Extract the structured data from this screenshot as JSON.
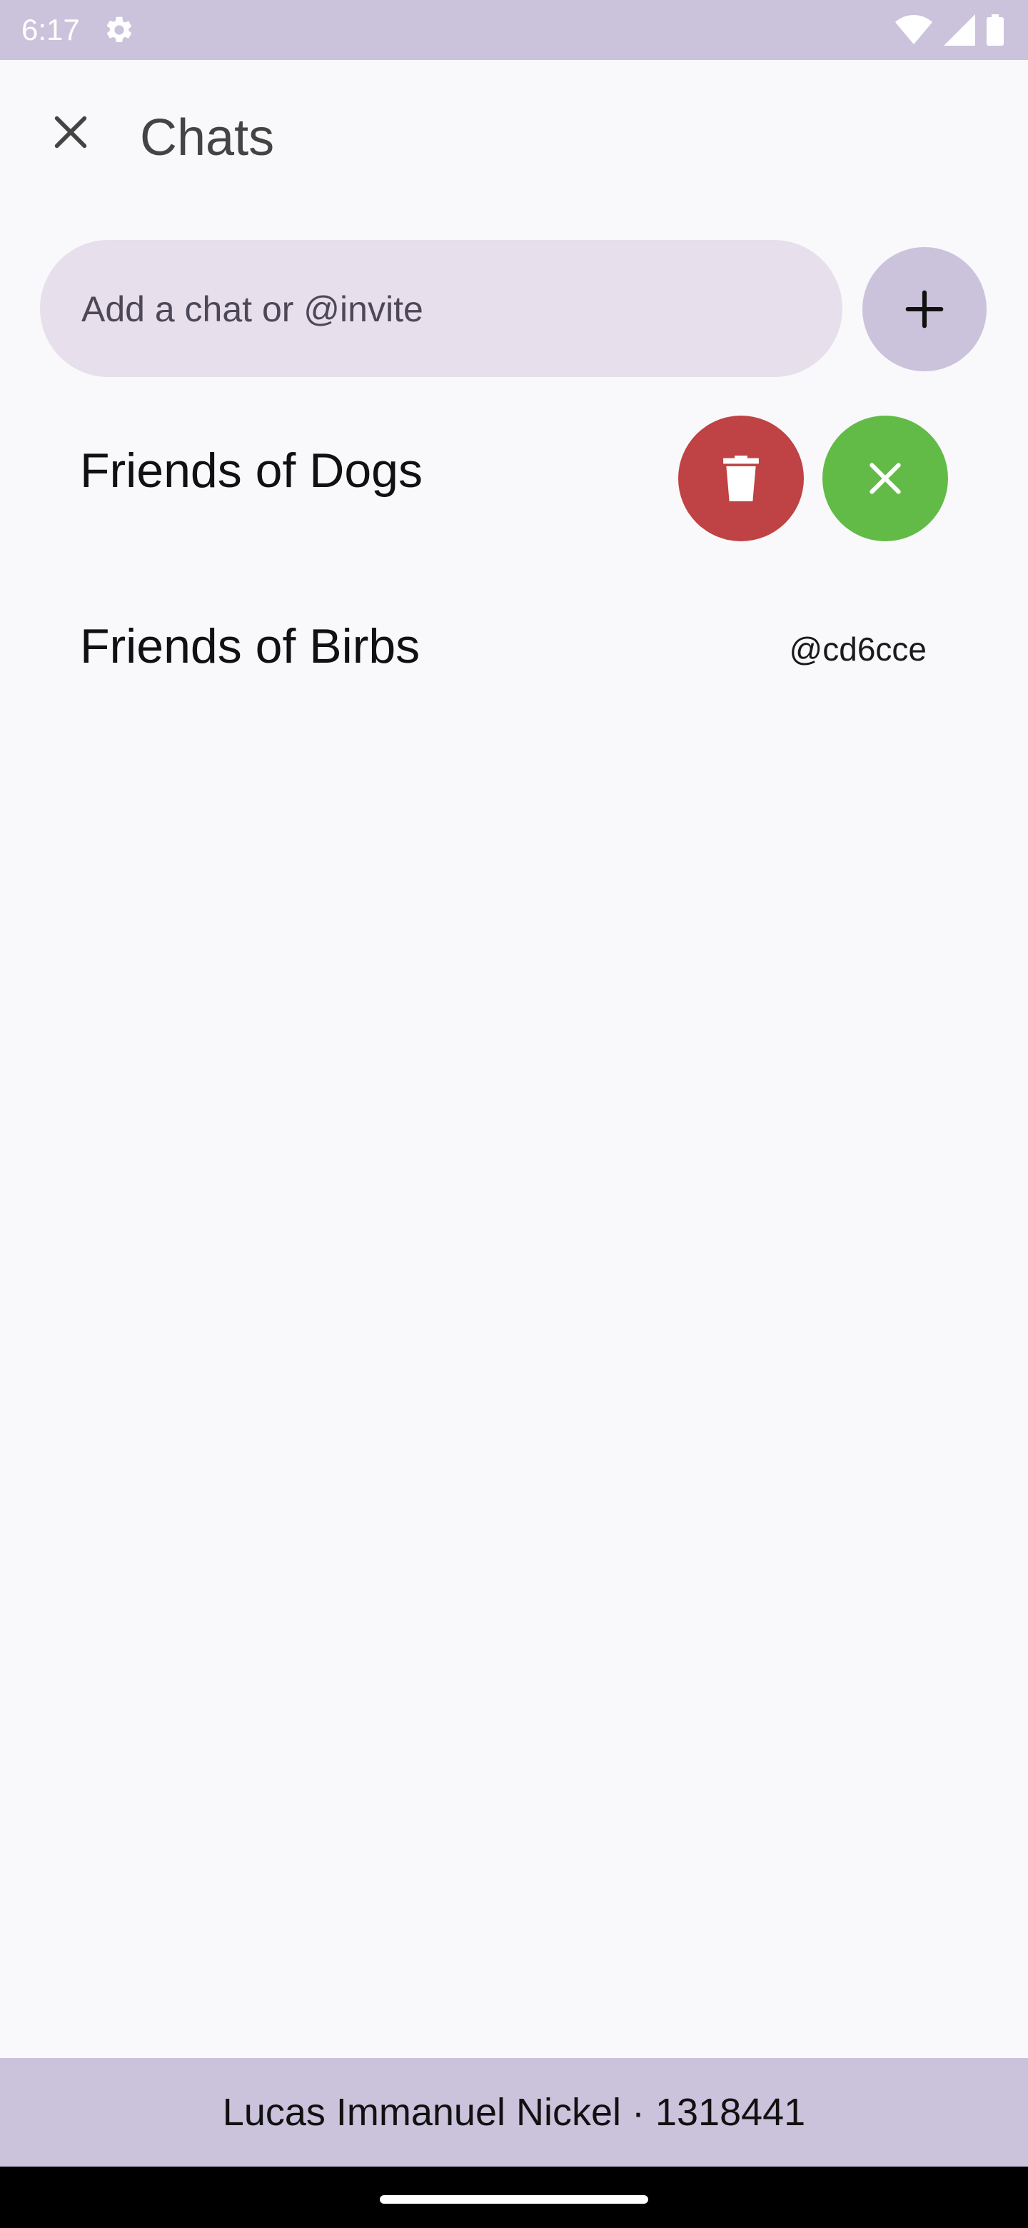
{
  "status_bar": {
    "time": "6:17",
    "icons": [
      "settings-icon",
      "wifi-icon",
      "signal-icon",
      "battery-icon"
    ]
  },
  "header": {
    "title": "Chats",
    "close_icon": "close-icon"
  },
  "composer": {
    "placeholder": "Add a chat or @invite",
    "add_icon": "plus-icon"
  },
  "chats": [
    {
      "name": "Friends of Dogs",
      "handle": "",
      "actions": [
        "delete",
        "confirm"
      ]
    },
    {
      "name": "Friends of Birbs",
      "handle": "@cd6cce"
    }
  ],
  "footer": {
    "text": "Lucas Immanuel Nickel · 1318441"
  },
  "colors": {
    "accent": "#cbc2dc",
    "input_bg": "#e7dfec",
    "delete": "#bf4244",
    "confirm": "#62bb47",
    "background": "#f9f9fb"
  }
}
